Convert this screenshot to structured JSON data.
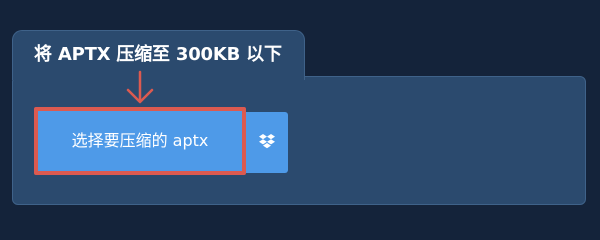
{
  "converter": {
    "title": "将 APTX 压缩至 300KB 以下",
    "upload_label": "选择要压缩的 aptx",
    "dropbox_icon": "dropbox-icon",
    "arrow_icon": "arrow-down-icon"
  },
  "colors": {
    "page_background": "#14233a",
    "panel_background": "#2b4a6e",
    "button_blue": "#4e9ae8",
    "highlight_red": "#dc5a50"
  }
}
